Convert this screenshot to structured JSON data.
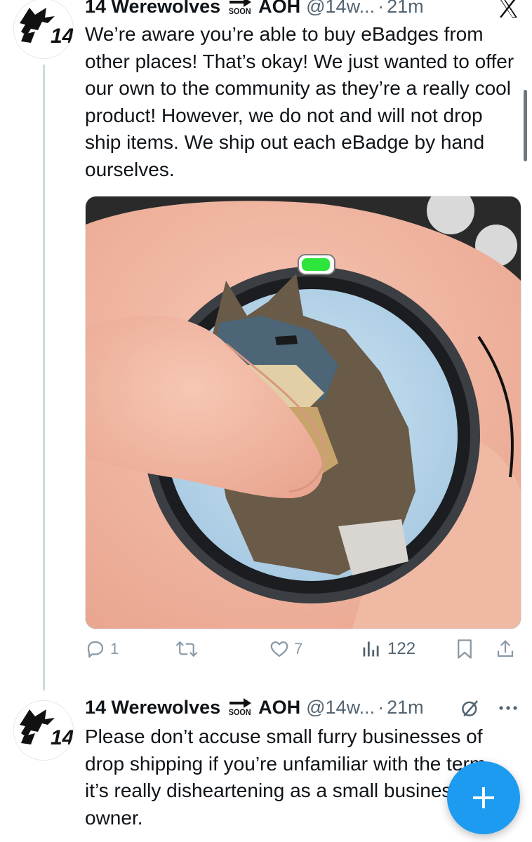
{
  "tweet1": {
    "display_name": "14 Werewolves",
    "badge_text": "SOON",
    "suffix_name": "AOH",
    "handle": "@14w...",
    "separator": "·",
    "time": "21m",
    "avatar_label": "14",
    "text": "We’re aware you’re able to buy eBadges from other places! That’s okay! We just wanted to offer our own to the community as they’re a really cool product! However, we do not and will not drop ship items. We ship out each eBadge by hand ourselves.",
    "close_icon": "x-close-icon",
    "media_icon": "photo-ebadge-wolf-image",
    "actions": {
      "replies": "1",
      "retweets": "",
      "likes": "7",
      "views": "122"
    }
  },
  "tweet2": {
    "display_name": "14 Werewolves",
    "badge_text": "SOON",
    "suffix_name": "AOH",
    "handle": "@14w...",
    "separator": "·",
    "time": "21m",
    "avatar_label": "14",
    "text": "Please don’t accuse small furry businesses of drop shipping if you’re unfamiliar with the term, it’s really disheartening as a small business owner."
  },
  "fab": {
    "label": "+",
    "icon": "plus-icon"
  },
  "colors": {
    "accent": "#1d9bf0",
    "text": "#0f1419",
    "muted": "#536471",
    "thread_line": "#cfd9de",
    "battery_green": "#2ee53b"
  }
}
